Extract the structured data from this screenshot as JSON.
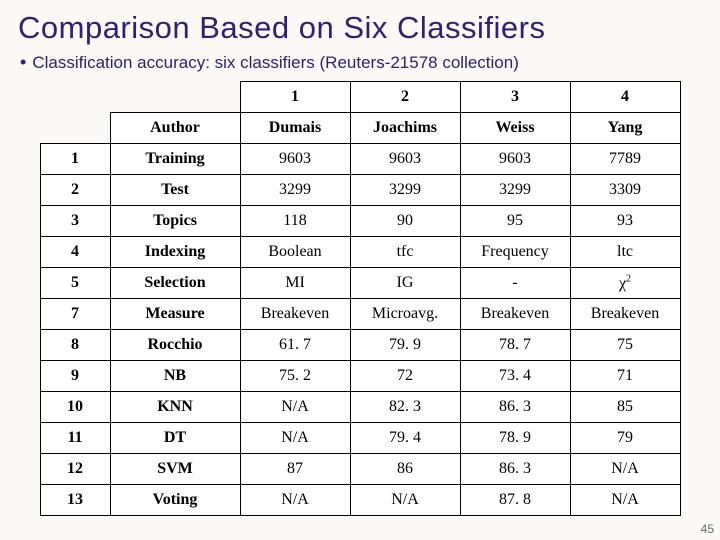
{
  "title": "Comparison Based on Six Classifiers",
  "bullet": "Classification accuracy: six classifiers (Reuters-21578 collection)",
  "page_number": "45",
  "chart_data": {
    "type": "table",
    "title": "Comparison Based on Six Classifiers",
    "col_headers_numeric": [
      "1",
      "2",
      "3",
      "4"
    ],
    "author_row_label": "Author",
    "authors": [
      "Dumais",
      "Joachims",
      "Weiss",
      "Yang"
    ],
    "rows": [
      {
        "n": "1",
        "label": "Training",
        "cells": [
          "9603",
          "9603",
          "9603",
          "7789"
        ]
      },
      {
        "n": "2",
        "label": "Test",
        "cells": [
          "3299",
          "3299",
          "3299",
          "3309"
        ]
      },
      {
        "n": "3",
        "label": "Topics",
        "cells": [
          "118",
          "90",
          "95",
          "93"
        ]
      },
      {
        "n": "4",
        "label": "Indexing",
        "cells": [
          "Boolean",
          "tfc",
          "Frequency",
          "ltc"
        ]
      },
      {
        "n": "5",
        "label": "Selection",
        "cells": [
          "MI",
          "IG",
          "-",
          "χ²"
        ]
      },
      {
        "n": "7",
        "label": "Measure",
        "cells": [
          "Breakeven",
          "Microavg.",
          "Breakeven",
          "Breakeven"
        ]
      },
      {
        "n": "8",
        "label": "Rocchio",
        "cells": [
          "61. 7",
          "79. 9",
          "78. 7",
          "75"
        ]
      },
      {
        "n": "9",
        "label": "NB",
        "cells": [
          "75. 2",
          "72",
          "73. 4",
          "71"
        ]
      },
      {
        "n": "10",
        "label": "KNN",
        "cells": [
          "N/A",
          "82. 3",
          "86. 3",
          "85"
        ]
      },
      {
        "n": "11",
        "label": "DT",
        "cells": [
          "N/A",
          "79. 4",
          "78. 9",
          "79"
        ]
      },
      {
        "n": "12",
        "label": "SVM",
        "cells": [
          "87",
          "86",
          "86. 3",
          "N/A"
        ]
      },
      {
        "n": "13",
        "label": "Voting",
        "cells": [
          "N/A",
          "N/A",
          "87. 8",
          "N/A"
        ]
      }
    ]
  }
}
